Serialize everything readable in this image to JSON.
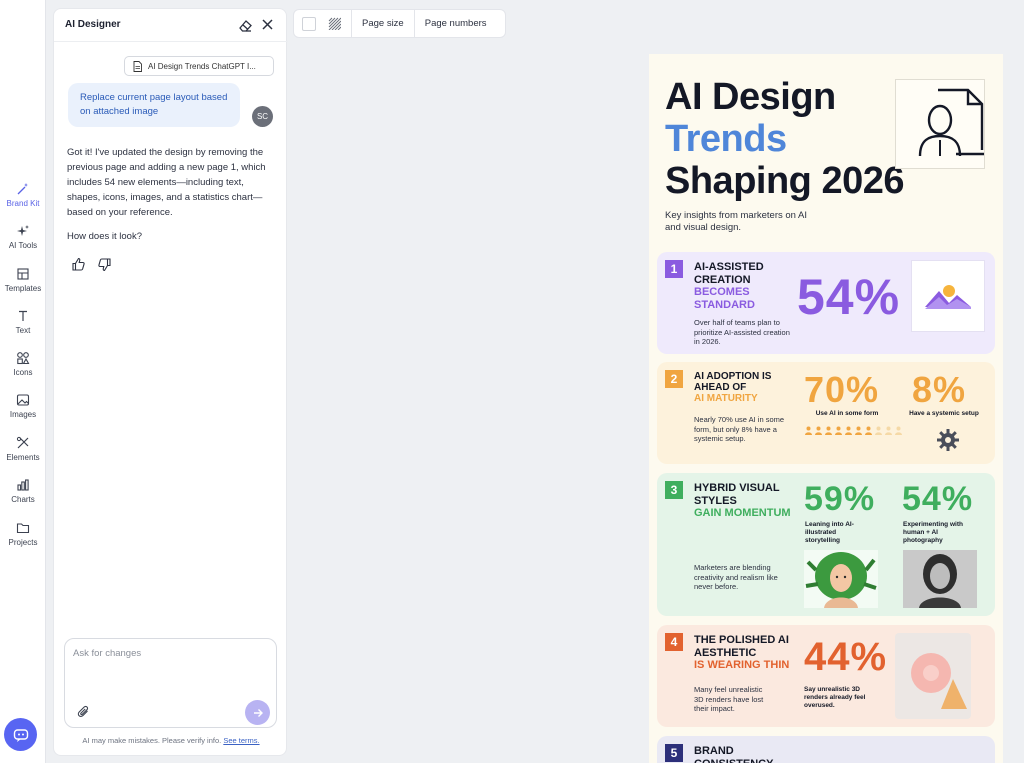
{
  "rail": {
    "items": [
      {
        "label": "Brand Kit",
        "icon": "magic-wand-icon"
      },
      {
        "label": "AI Tools",
        "icon": "sparkles-icon"
      },
      {
        "label": "Templates",
        "icon": "templates-icon"
      },
      {
        "label": "Text",
        "icon": "text-icon"
      },
      {
        "label": "Icons",
        "icon": "shapes-icon"
      },
      {
        "label": "Images",
        "icon": "image-icon"
      },
      {
        "label": "Elements",
        "icon": "elements-icon"
      },
      {
        "label": "Charts",
        "icon": "bar-chart-icon"
      },
      {
        "label": "Projects",
        "icon": "folder-icon"
      }
    ],
    "active": "Brand Kit"
  },
  "chat": {
    "title": "AI Designer",
    "attachment": "AI Design Trends ChatGPT I...",
    "user_message": "Replace current page layout based on attached image",
    "user_initials": "SC",
    "bot_message": "Got it! I've updated the design by removing the previous page and adding a new page 1, which includes 54 new elements—including text, shapes, icons, images, and a statistics chart—based on your reference.",
    "bot_question": "How does it look?",
    "input_placeholder": "Ask for changes",
    "disclaimer": "AI may make mistakes. Please verify info.",
    "disclaimer_link": "See terms."
  },
  "toolbar": {
    "page_size": "Page size",
    "page_numbers": "Page numbers"
  },
  "poster": {
    "title_line1": "AI Design",
    "title_line2": "Trends",
    "title_line3": "Shaping 2026",
    "subtitle": "Key insights from marketers on AI and visual design.",
    "cards": [
      {
        "num": "1",
        "head": "AI-ASSISTED CREATION",
        "accent": "BECOMES STANDARD",
        "body": "Over half of teams plan to prioritize AI-assisted creation in 2026.",
        "stat": "54%",
        "color": "#8a5be0",
        "bg": "#efeafc"
      },
      {
        "num": "2",
        "head": "AI ADOPTION IS AHEAD OF",
        "accent": "AI MATURITY",
        "body": "Nearly 70% use AI in some form, but only 8% have a systemic setup.",
        "stat_a": "70%",
        "label_a": "Use AI in some form",
        "stat_b": "8%",
        "label_b": "Have a systemic setup",
        "color": "#f0a540",
        "bg": "#fdf2dc"
      },
      {
        "num": "3",
        "head": "HYBRID VISUAL STYLES",
        "accent": "GAIN MOMENTUM",
        "body": "Marketers are blending creativity and realism like never before.",
        "stat_a": "59%",
        "label_a": "Leaning into AI-illustrated storytelling",
        "stat_b": "54%",
        "label_b": "Experimenting with human + AI photography",
        "color": "#3fae5e",
        "bg": "#e4f4e8"
      },
      {
        "num": "4",
        "head": "THE POLISHED AI AESTHETIC",
        "accent": "IS WEARING THIN",
        "body": "Many feel unrealistic 3D renders have lost their impact.",
        "stat": "44%",
        "label": "Say unrealistic 3D renders already feel overused.",
        "color": "#e2622f",
        "bg": "#fbe9df"
      },
      {
        "num": "5",
        "head": "BRAND CONSISTENCY",
        "color": "#2c2f7a",
        "bg": "#e9e9f4"
      }
    ]
  }
}
